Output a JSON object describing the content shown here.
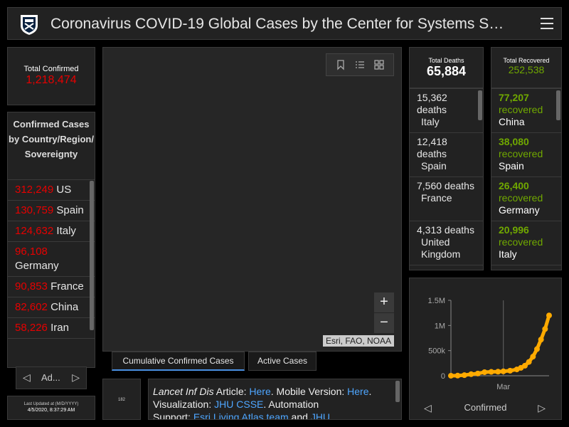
{
  "header": {
    "title": "Coronavirus COVID-19 Global Cases by the Center for Systems S…"
  },
  "confirmed": {
    "label": "Total Confirmed",
    "value": "1,218,474"
  },
  "country_list": {
    "heading": "Confirmed Cases by Country/Region/ Sovereignty",
    "items": [
      {
        "num": "312,249",
        "name": "US"
      },
      {
        "num": "130,759",
        "name": "Spain"
      },
      {
        "num": "124,632",
        "name": "Italy"
      },
      {
        "num": "96,108",
        "name": "Germany"
      },
      {
        "num": "90,853",
        "name": "France"
      },
      {
        "num": "82,602",
        "name": "China"
      },
      {
        "num": "58,226",
        "name": "Iran"
      }
    ],
    "pager_label": "Ad..."
  },
  "updated": {
    "label": "Last Updated at (M/D/YYYY)",
    "value": "4/5/2020, 8:37:29 AM"
  },
  "map": {
    "attribution": "Esri, FAO, NOAA",
    "zoom_in": "+",
    "zoom_out": "−"
  },
  "tabs": [
    {
      "label": "Cumulative Confirmed Cases"
    },
    {
      "label": "Active Cases"
    }
  ],
  "thumb_label": "182",
  "info": {
    "journal": "Lancet Inf Dis",
    "t1": " Article: ",
    "here1": "Here",
    "t2": ". Mobile Version: ",
    "here2": "Here",
    "t3": ".",
    "t4": "Visualization: ",
    "jhu": "JHU CSSE",
    "t5": ". Automation",
    "t6": "Support: ",
    "esri": "Esri Living Atlas team",
    "t7": " and ",
    "jhu2": "JHU"
  },
  "deaths": {
    "label": "Total Deaths",
    "value": "65,884",
    "items": [
      {
        "text": "15,362 deaths",
        "country": "Italy"
      },
      {
        "text": "12,418 deaths",
        "country": "Spain"
      },
      {
        "text": "7,560 deaths",
        "country": "France"
      },
      {
        "text": "4,313 deaths",
        "country": "United Kingdom"
      }
    ]
  },
  "recovered": {
    "label": "Total Recovered",
    "value": "252,538",
    "items": [
      {
        "num": "77,207",
        "word": "recovered",
        "country": "China"
      },
      {
        "num": "38,080",
        "word": "recovered",
        "country": "Spain"
      },
      {
        "num": "26,400",
        "word": "recovered",
        "country": "Germany"
      },
      {
        "num": "20,996",
        "word": "recovered",
        "country": "Italy"
      }
    ]
  },
  "chart_data": {
    "type": "scatter",
    "y_ticks": [
      "1.5M",
      "1M",
      "500k",
      "0"
    ],
    "x_tick": "Mar",
    "nav_label": "Confirmed",
    "ylim": [
      0,
      1500000
    ],
    "x_range": [
      "2020-01-22",
      "2020-04-04"
    ],
    "x_tick_date": "2020-03-01",
    "colors": {
      "points": "#ffaa00",
      "axis": "#888888"
    },
    "x": [
      "2020-01-22",
      "2020-01-27",
      "2020-02-01",
      "2020-02-06",
      "2020-02-11",
      "2020-02-16",
      "2020-02-21",
      "2020-02-26",
      "2020-03-01",
      "2020-03-06",
      "2020-03-11",
      "2020-03-14",
      "2020-03-17",
      "2020-03-20",
      "2020-03-23",
      "2020-03-26",
      "2020-03-29",
      "2020-04-01",
      "2020-04-04"
    ],
    "y": [
      555,
      2900,
      12000,
      31000,
      45000,
      71000,
      77000,
      81000,
      88000,
      101000,
      126000,
      157000,
      200000,
      275000,
      380000,
      530000,
      720000,
      930000,
      1200000
    ]
  }
}
